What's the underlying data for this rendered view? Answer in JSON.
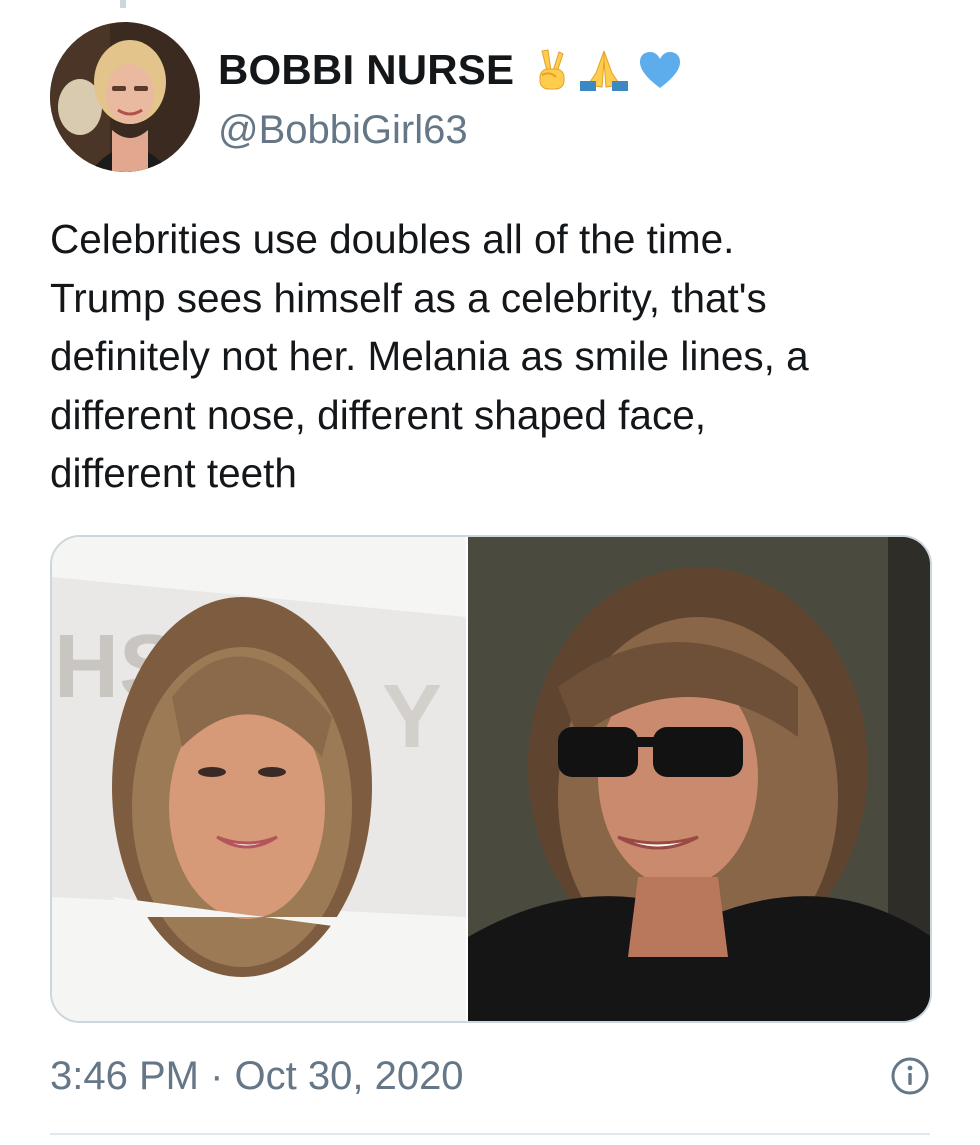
{
  "tweet": {
    "author": {
      "display_name": "BOBBI NURSE",
      "name_emojis": [
        "victory-hand-emoji",
        "folded-hands-emoji",
        "blue-heart-emoji"
      ],
      "handle": "@BobbiGirl63",
      "avatar": "avatar"
    },
    "text_lines": [
      "Celebrities use doubles all of the time.",
      "Trump sees himself as a celebrity, that's",
      "definitely not her. Melania as smile lines, a",
      "different nose, different shaped face,",
      "different teeth"
    ],
    "media": [
      {
        "name": "photo-left",
        "description_icon": "photo"
      },
      {
        "name": "photo-right",
        "description_icon": "photo"
      }
    ],
    "timestamp": "3:46 PM · Oct 30, 2020",
    "info_icon": "info-icon"
  },
  "colors": {
    "text_primary": "#14171a",
    "text_secondary": "#657786",
    "border": "#ccd6dd",
    "heart_blue": "#5dadec",
    "emoji_yellow": "#ffcc4d"
  }
}
